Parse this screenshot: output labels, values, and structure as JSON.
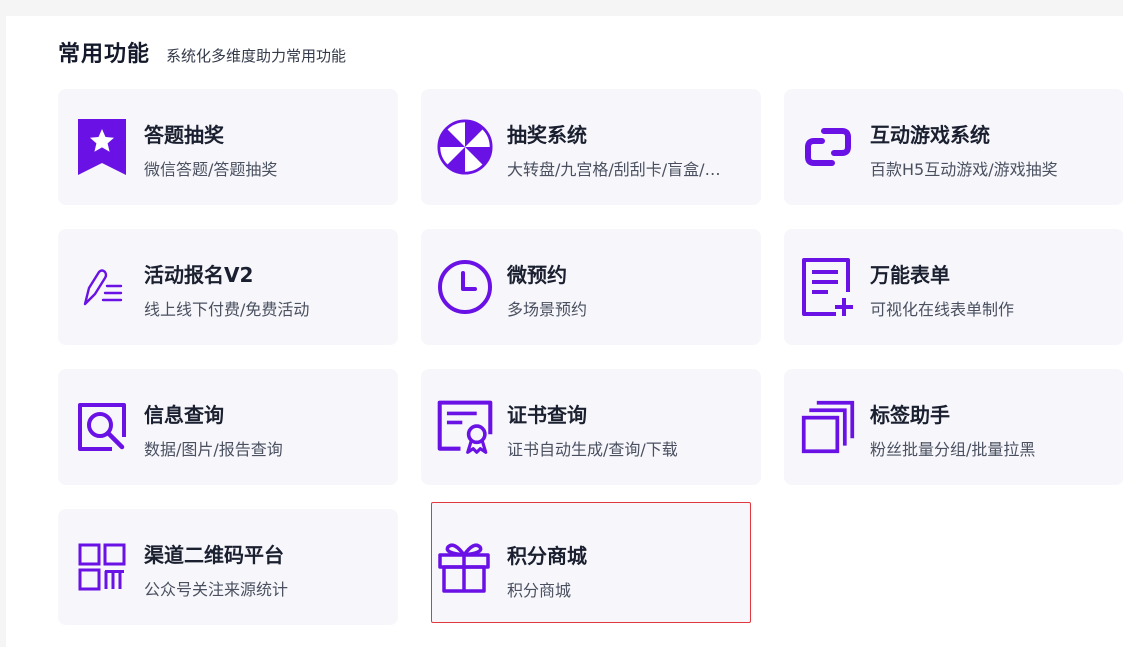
{
  "section": {
    "title": "常用功能",
    "subtitle": "系统化多维度助力常用功能"
  },
  "accent": "#6a11e6",
  "cards": [
    {
      "title": "答题抽奖",
      "desc": "微信答题/答题抽奖",
      "icon": "star-ribbon-icon"
    },
    {
      "title": "抽奖系统",
      "desc": "大转盘/九宫格/刮刮卡/盲盒/…",
      "icon": "wheel-icon"
    },
    {
      "title": "互动游戏系统",
      "desc": "百款H5互动游戏/游戏抽奖",
      "icon": "link-icon"
    },
    {
      "title": "活动报名V2",
      "desc": "线上线下付费/免费活动",
      "icon": "pen-list-icon"
    },
    {
      "title": "微预约",
      "desc": "多场景预约",
      "icon": "clock-icon"
    },
    {
      "title": "万能表单",
      "desc": "可视化在线表单制作",
      "icon": "form-plus-icon"
    },
    {
      "title": "信息查询",
      "desc": "数据/图片/报告查询",
      "icon": "search-frame-icon"
    },
    {
      "title": "证书查询",
      "desc": "证书自动生成/查询/下载",
      "icon": "certificate-icon"
    },
    {
      "title": "标签助手",
      "desc": "粉丝批量分组/批量拉黑",
      "icon": "stacked-squares-icon"
    },
    {
      "title": "渠道二维码平台",
      "desc": "公众号关注来源统计",
      "icon": "qr-grid-icon"
    },
    {
      "title": "积分商城",
      "desc": "积分商城",
      "icon": "gift-icon"
    }
  ]
}
